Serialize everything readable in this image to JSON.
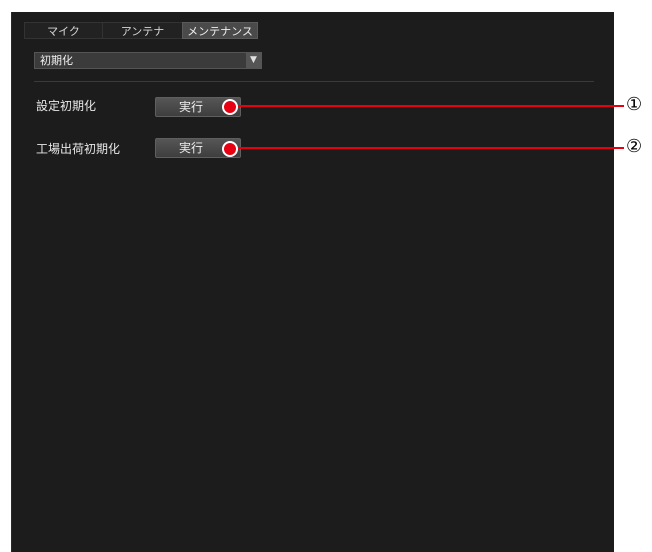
{
  "tabs": [
    {
      "label": "マイク",
      "active": false
    },
    {
      "label": "アンテナ",
      "active": false
    },
    {
      "label": "メンテナンス",
      "active": true
    }
  ],
  "select": {
    "value": "初期化",
    "arrow": "▼"
  },
  "rows": [
    {
      "label": "設定初期化",
      "button": "実行",
      "callout": "①"
    },
    {
      "label": "工場出荷初期化",
      "button": "実行",
      "callout": "②"
    }
  ],
  "colors": {
    "panel_bg": "#1c1c1c",
    "callout": "#e60012"
  }
}
